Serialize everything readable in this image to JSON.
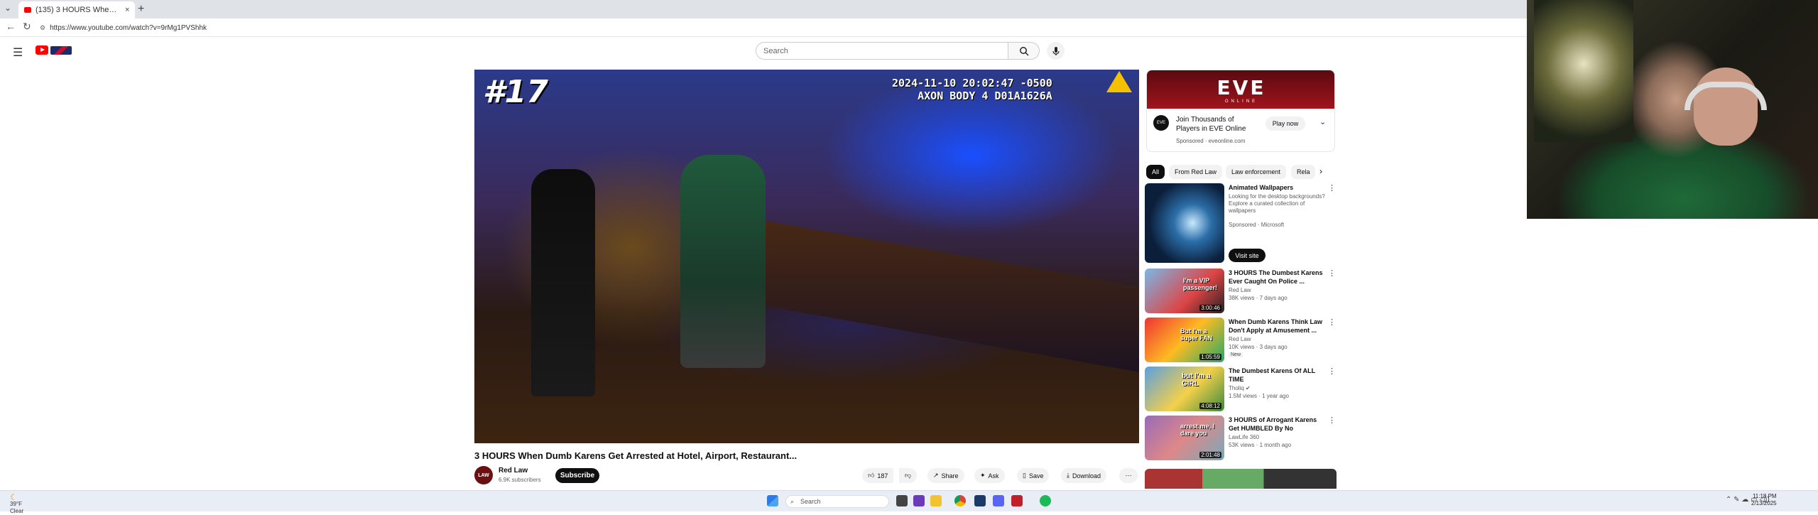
{
  "browser": {
    "tab_title": "(135) 3 HOURS When Dumb...",
    "tab_close": "×",
    "new_tab": "+",
    "url": "https://www.youtube.com/watch?v=9rMg1PVShhk"
  },
  "yt": {
    "search_placeholder": "Search"
  },
  "video": {
    "overlay_number": "#17",
    "overlay_timestamp": "2024-11-10 20:02:47 -0500",
    "overlay_device": "AXON BODY 4 D01A1626A",
    "title": "3 HOURS When Dumb Karens Get Arrested at Hotel, Airport, Restaurant...",
    "channel": "Red Law",
    "channel_avatar_text": "LAW",
    "subscribers": "6.9K subscribers",
    "subscribe": "Subscribe",
    "likes": "187",
    "share": "Share",
    "ask": "Ask",
    "save": "Save",
    "download": "Download",
    "more": "⋯"
  },
  "ad": {
    "brand": "EVE",
    "brand_sub": "ONLINE",
    "logo_text": "EVE",
    "text": "Join Thousands of Players in EVE Online",
    "sponsored": "Sponsored · eveonline.com",
    "cta": "Play now"
  },
  "chips": [
    "All",
    "From Red Law",
    "Law enforcement",
    "Rela"
  ],
  "sidebar_ad": {
    "title": "Animated Wallpapers",
    "desc": "Looking for the desktop backgrounds? Explore a curated collection of wallpapers",
    "sponsored": "Sponsored · Microsoft",
    "cta": "Visit site"
  },
  "recommendations": [
    {
      "title": "3 HOURS The Dumbest Karens Ever Caught On Police ...",
      "channel": "Red Law",
      "meta": "38K views · 7 days ago",
      "duration": "3:00:46",
      "thumb_text": "I'm a VIP passenger!"
    },
    {
      "title": "When Dumb Karens Think Law Don't Apply at Amusement ...",
      "channel": "Red Law",
      "meta": "10K views · 3 days ago",
      "duration": "1:05:59",
      "badge": "New",
      "thumb_text": "But I'm a super FAN"
    },
    {
      "title": "The Dumbest Karens Of ALL TIME",
      "channel": "Tholiq ✔",
      "meta": "1.5M views · 1 year ago",
      "duration": "4:08:12",
      "thumb_text": "but I'm a GIRL"
    },
    {
      "title": "3 HOURS of Arrogant Karens Get HUMBLED By No Nonsens...",
      "channel": "LawLife 360",
      "meta": "53K views · 1 month ago",
      "duration": "2:01:48",
      "thumb_text": "arrest me, I dare you"
    }
  ],
  "taskbar": {
    "weather_temp": "39°F",
    "weather_desc": "Clear",
    "search": "Search",
    "time": "11:18 PM",
    "date": "2/13/2025"
  }
}
